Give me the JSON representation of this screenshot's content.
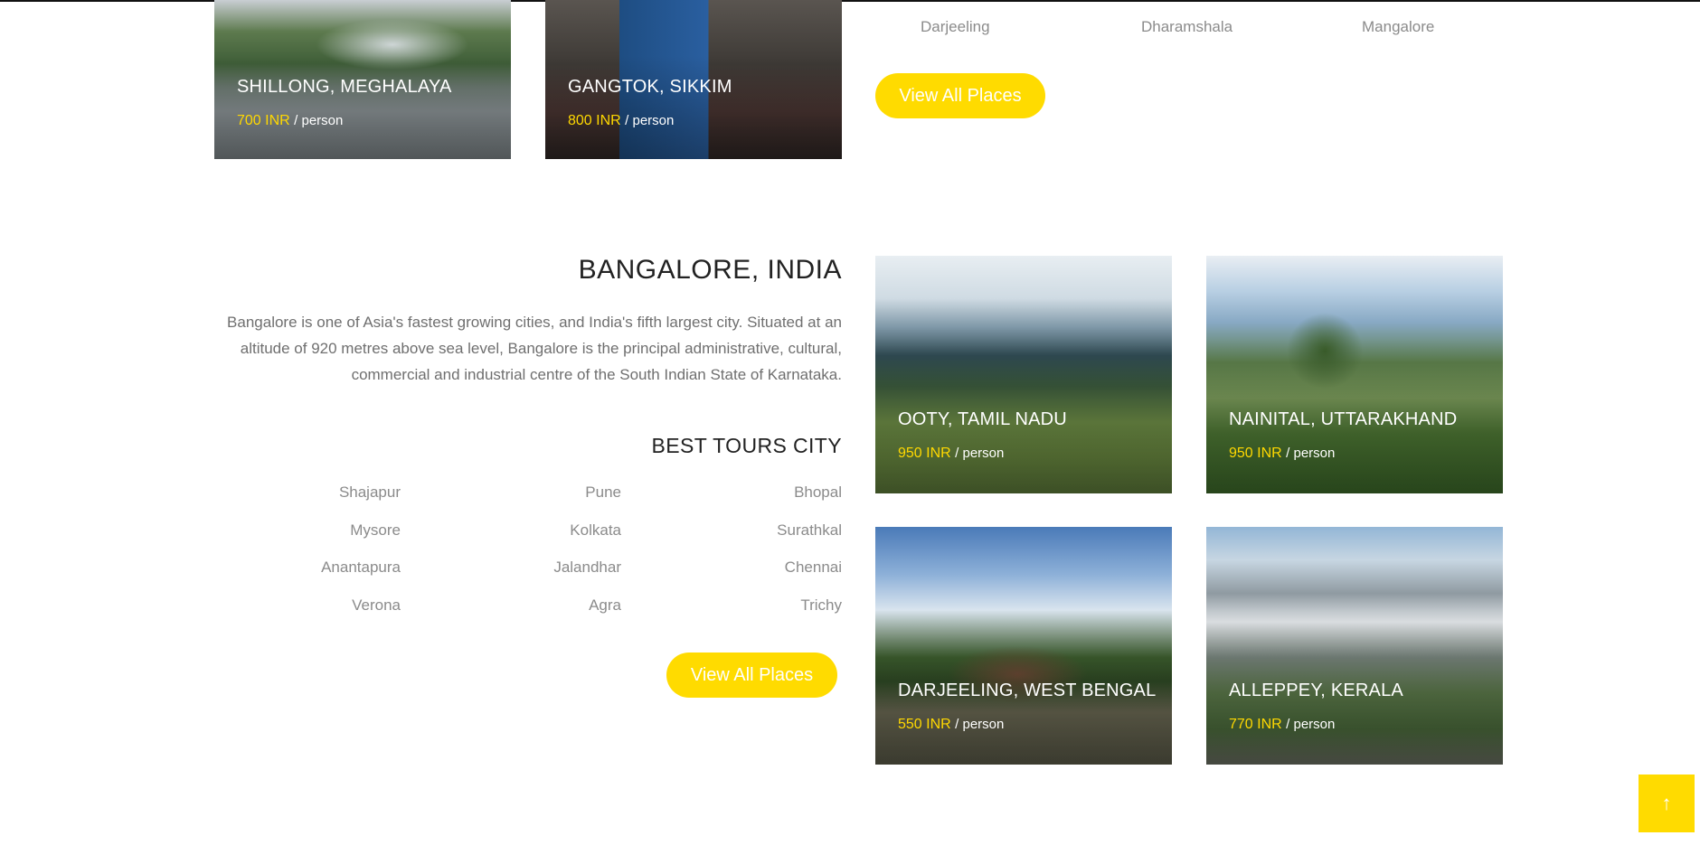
{
  "top_section": {
    "cards": [
      {
        "title": "SHILLONG, MEGHALAYA",
        "price": "700 INR",
        "per": "/ person"
      },
      {
        "title": "GANGTOK, SIKKIM",
        "price": "800 INR",
        "per": "/ person"
      }
    ],
    "cities": [
      "Darjeeling",
      "Dharamshala",
      "Mangalore"
    ],
    "view_all": "View All Places"
  },
  "bangalore_section": {
    "title": "BANGALORE, INDIA",
    "description": "Bangalore is one of Asia's fastest growing cities, and India's fifth largest city. Situated at an altitude of 920 metres above sea level, Bangalore is the principal administrative, cultural, commercial and industrial centre of the South Indian State of Karnataka.",
    "best_tours_title": "BEST TOURS CITY",
    "cities": [
      [
        "Shajapur",
        "Pune",
        "Bhopal"
      ],
      [
        "Mysore",
        "Kolkata",
        "Surathkal"
      ],
      [
        "Anantapura",
        "Jalandhar",
        "Chennai"
      ],
      [
        "Verona",
        "Agra",
        "Trichy"
      ]
    ],
    "view_all": "View All Places",
    "cards": [
      {
        "title": "OOTY, TAMIL NADU",
        "price": "950 INR",
        "per": "/ person"
      },
      {
        "title": "NAINITAL, UTTARAKHAND",
        "price": "950 INR",
        "per": "/ person"
      },
      {
        "title": "DARJEELING, WEST BENGAL",
        "price": "550 INR",
        "per": "/ person"
      },
      {
        "title": "ALLEPPEY, KERALA",
        "price": "770 INR",
        "per": "/ person"
      }
    ]
  },
  "scroll_top_icon": "arrow-up-icon",
  "colors": {
    "accent": "#ffdb00",
    "price": "#ffd800"
  }
}
